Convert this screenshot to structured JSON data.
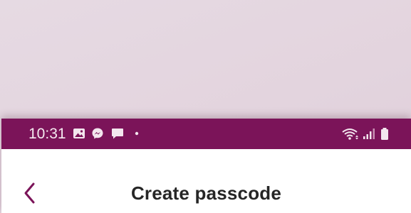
{
  "status_bar": {
    "time": "10:31",
    "background": "#7b1459",
    "notification_icons": [
      "gallery-icon",
      "messenger-icon",
      "chat-bubble-icon",
      "more-notifications-dot-icon"
    ],
    "system_icons": [
      "wifi-icon",
      "signal-icon",
      "battery-icon"
    ]
  },
  "header": {
    "title": "Create passcode",
    "back_icon": "chevron-left-icon",
    "accent": "#7b1459"
  }
}
